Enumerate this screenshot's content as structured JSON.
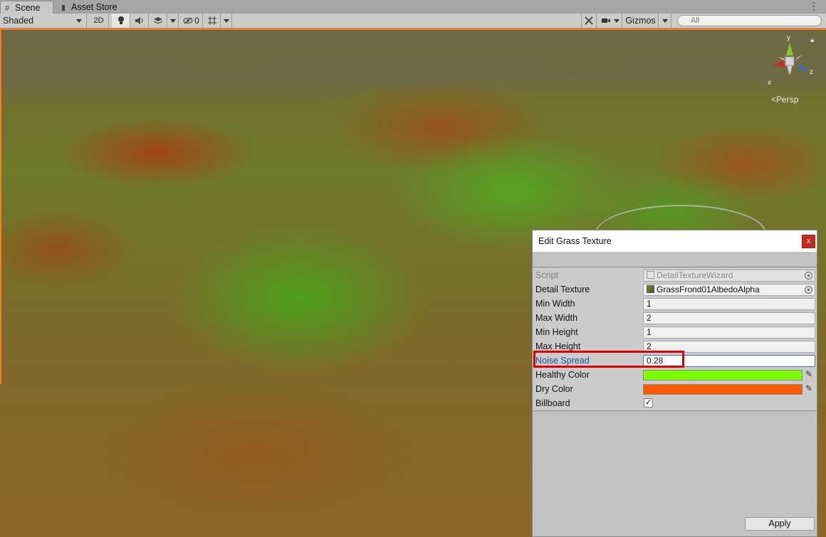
{
  "tabs": [
    {
      "label": "Scene",
      "icon": "hash-icon",
      "active": true
    },
    {
      "label": "Asset Store",
      "icon": "bag-icon",
      "active": false
    }
  ],
  "toolbar": {
    "shading_mode": "Shaded",
    "mode_2d": "2D",
    "hidden_count": "0",
    "gizmos_label": "Gizmos",
    "search_placeholder": "All"
  },
  "scene": {
    "projection_label": "Persp",
    "gizmo_axes": {
      "x": "x",
      "y": "y",
      "z": "z"
    },
    "colors": {
      "selection_outline": "#ff7a1a"
    }
  },
  "wizard": {
    "title": "Edit Grass Texture",
    "close_label": "x",
    "apply_label": "Apply",
    "fields": {
      "script": {
        "label": "Script",
        "value": "DetailTextureWizard"
      },
      "detail_texture": {
        "label": "Detail Texture",
        "value": "GrassFrond01AlbedoAlpha"
      },
      "min_width": {
        "label": "Min Width",
        "value": "1"
      },
      "max_width": {
        "label": "Max Width",
        "value": "2"
      },
      "min_height": {
        "label": "Min Height",
        "value": "1"
      },
      "max_height": {
        "label": "Max Height",
        "value": "2"
      },
      "noise_spread": {
        "label": "Noise Spread",
        "value": "0.28"
      },
      "healthy_color": {
        "label": "Healthy Color",
        "color": "#7cff00"
      },
      "dry_color": {
        "label": "Dry Color",
        "color": "#ff5a00"
      },
      "billboard": {
        "label": "Billboard",
        "checked": true,
        "mark": "✓"
      }
    },
    "highlight_color": "#e00000"
  }
}
